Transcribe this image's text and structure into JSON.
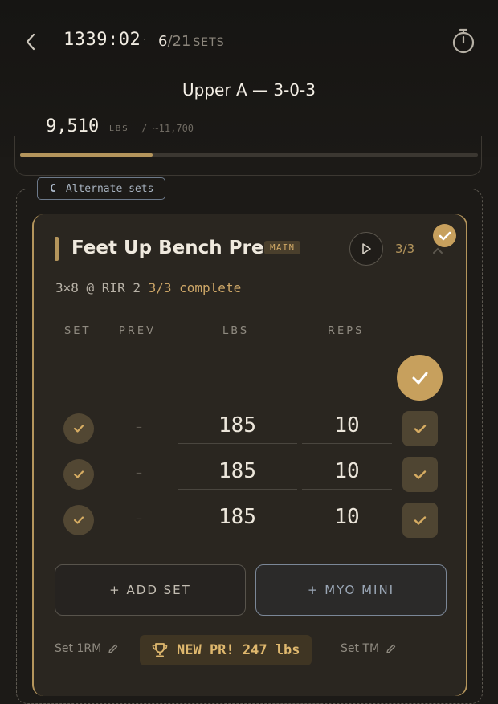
{
  "header": {
    "timer": "1339:02",
    "separator": "·",
    "sets_done": "6",
    "sets_total": "/21",
    "sets_label": "SETS",
    "workout_title": "Upper A — 3-0-3",
    "volume": "9,510",
    "volume_unit": "LBS",
    "volume_target": "/ ~11,700",
    "volume_progress": 0.29
  },
  "alternate_tag": {
    "letter": "C",
    "label": "Alternate sets"
  },
  "exercise": {
    "name": "Feet Up Bench Press",
    "badge": "MAIN",
    "progress": "3/3",
    "prescription": "3×8 @ RIR 2",
    "complete_text": "3/3 complete",
    "columns": {
      "set": "SET",
      "prev": "PREV",
      "lbs": "LBS",
      "reps": "REPS"
    },
    "sets": [
      {
        "prev": "–",
        "lbs": "185",
        "reps": "10"
      },
      {
        "prev": "–",
        "lbs": "185",
        "reps": "10"
      },
      {
        "prev": "–",
        "lbs": "185",
        "reps": "10"
      }
    ],
    "add_set_label": "+ ADD SET",
    "myo_label": "+ MYO MINI",
    "set_1rm_label": "Set 1RM",
    "pr_label": "NEW PR! 247 lbs",
    "set_tm_label": "Set TM"
  },
  "colors": {
    "accent": "#b4955c",
    "background": "#1c1a17",
    "card": "#2a2620",
    "alt_blue": "#a7b2bf"
  },
  "icons": [
    "back-chevron-icon",
    "stopwatch-icon",
    "play-icon",
    "check-icon",
    "chevron-up-icon",
    "pencil-icon",
    "trophy-icon"
  ]
}
